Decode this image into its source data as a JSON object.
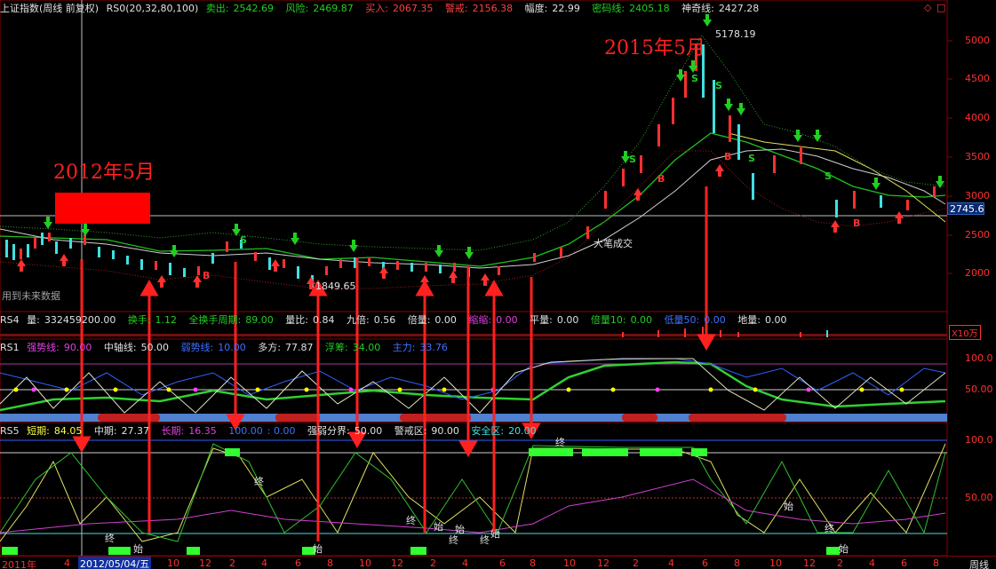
{
  "header": {
    "symbol": "上证指数(周线 前复权)",
    "indicator": "RS0(20,32,80,100)",
    "sell_label": "卖出:",
    "sell_value": "2542.69",
    "risk_label": "风险:",
    "risk_value": "2469.87",
    "buy_label": "买入:",
    "buy_value": "2067.35",
    "alert_label": "警戒:",
    "alert_value": "2156.38",
    "amp_label": "幅度:",
    "amp_value": "22.99",
    "secret_label": "密码线:",
    "secret_value": "2405.18",
    "magic_label": "神奇线:",
    "magic_value": "2427.28"
  },
  "rs4": {
    "name": "RS4",
    "vol_label": "量:",
    "vol_value": "332459200.00",
    "turnover_label": "换手:",
    "turnover_value": "1.12",
    "full_turnover_label": "全换手周期:",
    "full_turnover_value": "89.00",
    "ratio_label": "量比:",
    "ratio_value": "0.84",
    "jiubei_label": "九倍:",
    "jiubei_value": "0.56",
    "double_label": "倍量:",
    "double_value": "0.00",
    "shrink_label": "缩缩:",
    "shrink_value": "0.00",
    "flat_label": "平量:",
    "flat_value": "0.00",
    "tenfold_label": "倍量10:",
    "tenfold_value": "0.00",
    "low_label": "低量50:",
    "low_value": "0.00",
    "ground_label": "地量:",
    "ground_value": "0.00"
  },
  "rs1": {
    "name": "RS1",
    "strong_label": "强势线:",
    "strong_value": "90.00",
    "mid_label": "中轴线:",
    "mid_value": "50.00",
    "weak_label": "弱势线:",
    "weak_value": "10.00",
    "bull_label": "多方:",
    "bull_value": "77.87",
    "float_label": "浮筹:",
    "float_value": "34.00",
    "main_label": "主力:",
    "main_value": "33.76"
  },
  "rs5": {
    "name": "RS5",
    "short_label": "短期:",
    "short_value": "84.05",
    "mid_label": "中期:",
    "mid_value": "27.37",
    "long_label": "长期:",
    "long_value": "16.35",
    "v100_label": "100.00",
    "v0_label": ": 0.00",
    "strong_weak_label": "强弱分界:",
    "strong_weak_value": "50.00",
    "alert_label": "警戒区:",
    "alert_value": "90.00",
    "safe_label": "安全区:",
    "safe_value": "20.00"
  },
  "price_axis": [
    "5000",
    "4500",
    "4000",
    "3500",
    "3000",
    "2500",
    "2000"
  ],
  "price_tag": "2745.6",
  "rs1_axis": [
    "100.0",
    "50.00"
  ],
  "rs5_axis": [
    "100.0",
    "50.00"
  ],
  "unit_label": "X10万",
  "annotations": {
    "year_2012": "2012年5月",
    "year_2015": "2015年5月",
    "max_price": "5178.19",
    "min_price": "1849.65",
    "future_data": "用到未来数据",
    "big_trade": "大笔成交"
  },
  "date_axis": {
    "labels": [
      "2011年",
      "4",
      "10",
      "12",
      "2",
      "4",
      "6",
      "8",
      "10",
      "12",
      "2",
      "4",
      "6",
      "8",
      "10",
      "12",
      "2",
      "4",
      "6",
      "8",
      "10",
      "12",
      "2",
      "4",
      "6",
      "8"
    ],
    "cursor": "2012/05/04/五",
    "period": "周线"
  },
  "controls": {
    "diamond": "◇",
    "box": "□"
  },
  "colors": {
    "up": "#ff3030",
    "down": "#40e0e0",
    "buy_signal": "#ff3030",
    "sell_signal": "#20d020",
    "grid": "#8a0000"
  }
}
